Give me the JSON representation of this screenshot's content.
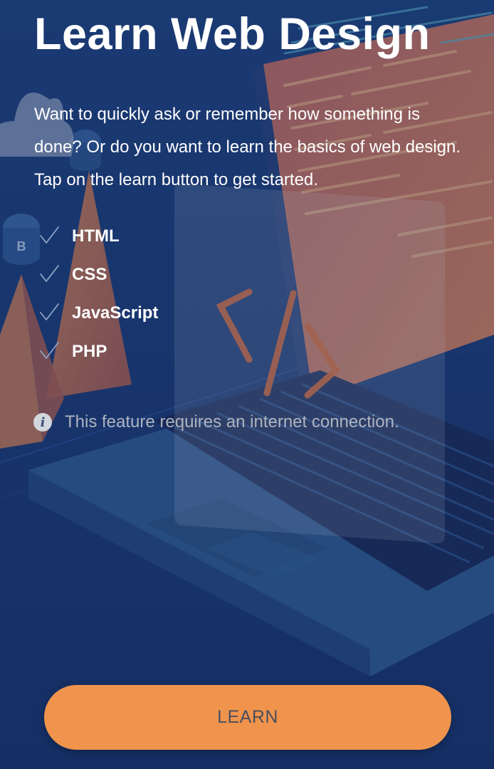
{
  "title": "Learn Web Design",
  "description": "Want to quickly ask or remember how something is done? Or do you want to learn the basics of web design. Tap on the learn button to get started.",
  "features": [
    {
      "label": "HTML",
      "icon": "check-icon"
    },
    {
      "label": "CSS",
      "icon": "check-icon"
    },
    {
      "label": "JavaScript",
      "icon": "check-icon"
    },
    {
      "label": "PHP",
      "icon": "check-icon"
    }
  ],
  "notice": {
    "icon": "info-icon",
    "text": "This feature requires an internet connection."
  },
  "button": {
    "label": "LEARN",
    "color": "#f0944d"
  },
  "colors": {
    "background": "#1b3a72",
    "accent_orange": "#f0944d",
    "text_primary": "#ffffff",
    "text_muted": "#aeb3bf"
  }
}
